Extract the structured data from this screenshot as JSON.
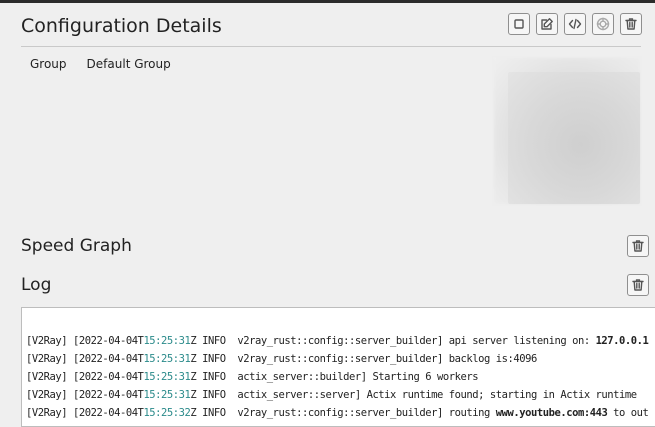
{
  "config": {
    "title": "Configuration Details",
    "toolbar": [
      {
        "name": "select-toggle-button",
        "icon": "square-icon",
        "enabled": true
      },
      {
        "name": "edit-button",
        "icon": "edit-icon",
        "enabled": true
      },
      {
        "name": "code-button",
        "icon": "code-icon",
        "enabled": true
      },
      {
        "name": "share-button",
        "icon": "share-icon",
        "enabled": false
      },
      {
        "name": "delete-button",
        "icon": "trash-icon",
        "enabled": true
      }
    ],
    "group_label": "Group",
    "group_value": "Default Group"
  },
  "speed_graph": {
    "title": "Speed Graph"
  },
  "log": {
    "title": "Log",
    "lines": [
      {
        "pre": "[V2Ray] [2022-04-04T",
        "time": "15:25:31",
        "post": "Z INFO  v2ray_rust::config::server_builder] api server listening on: ",
        "hl": "127.0.0.1",
        "tail": ""
      },
      {
        "pre": "[V2Ray] [2022-04-04T",
        "time": "15:25:31",
        "post": "Z INFO  v2ray_rust::config::server_builder] backlog is:4096",
        "hl": "",
        "tail": ""
      },
      {
        "pre": "[V2Ray] [2022-04-04T",
        "time": "15:25:31",
        "post": "Z INFO  actix_server::builder] Starting 6 workers",
        "hl": "",
        "tail": ""
      },
      {
        "pre": "[V2Ray] [2022-04-04T",
        "time": "15:25:31",
        "post": "Z INFO  actix_server::server] Actix runtime found; starting in Actix runtime",
        "hl": "",
        "tail": ""
      },
      {
        "pre": "[V2Ray] [2022-04-04T",
        "time": "15:25:32",
        "post": "Z INFO  v2ray_rust::config::server_builder] routing ",
        "hl": "www.youtube.com:443",
        "tail": " to out"
      }
    ]
  }
}
